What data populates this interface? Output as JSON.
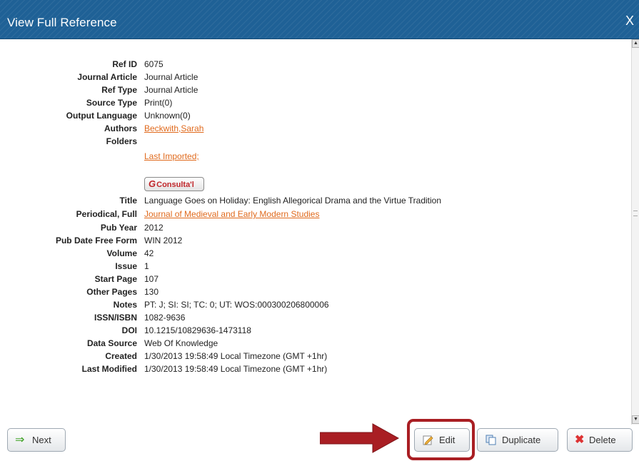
{
  "window": {
    "title": "View Full Reference",
    "close_label": "X"
  },
  "fields": [
    {
      "label": "Ref ID",
      "value": "6075"
    },
    {
      "label": "Journal Article",
      "value": "Journal Article"
    },
    {
      "label": "Ref Type",
      "value": "Journal Article"
    },
    {
      "label": "Source Type",
      "value": "Print(0)"
    },
    {
      "label": "Output Language",
      "value": "Unknown(0)"
    },
    {
      "label": "Authors",
      "value": "Beckwith,Sarah"
    },
    {
      "label": "Folders",
      "value": ""
    },
    {
      "label": "",
      "value": "Last Imported;"
    },
    {
      "label": "Title",
      "value": "Language Goes on Holiday: English Allegorical Drama and the Virtue Tradition"
    },
    {
      "label": "Periodical, Full",
      "value": "Journal of Medieval and Early Modern Studies"
    },
    {
      "label": "Pub Year",
      "value": "2012"
    },
    {
      "label": "Pub Date Free Form",
      "value": "WIN 2012"
    },
    {
      "label": "Volume",
      "value": "42"
    },
    {
      "label": "Issue",
      "value": "1"
    },
    {
      "label": "Start Page",
      "value": "107"
    },
    {
      "label": "Other Pages",
      "value": "130"
    },
    {
      "label": "Notes",
      "value": "PT: J; SI: SI; TC: 0; UT: WOS:000300206800006"
    },
    {
      "label": "ISSN/ISBN",
      "value": "1082-9636"
    },
    {
      "label": "DOI",
      "value": "10.1215/10829636-1473118"
    },
    {
      "label": "Data Source",
      "value": "Web Of Knowledge"
    },
    {
      "label": "Created",
      "value": "1/30/2013 19:58:49 Local Timezone (GMT +1hr)"
    },
    {
      "label": "Last Modified",
      "value": "1/30/2013 19:58:49 Local Timezone (GMT +1hr)"
    }
  ],
  "consulta_button": {
    "label": "Consulta'l"
  },
  "buttons": {
    "next": "Next",
    "edit": "Edit",
    "duplicate": "Duplicate",
    "delete": "Delete"
  },
  "colors": {
    "titlebar": "#1f6196",
    "link": "#e06a1d",
    "highlight": "#a91e23"
  }
}
